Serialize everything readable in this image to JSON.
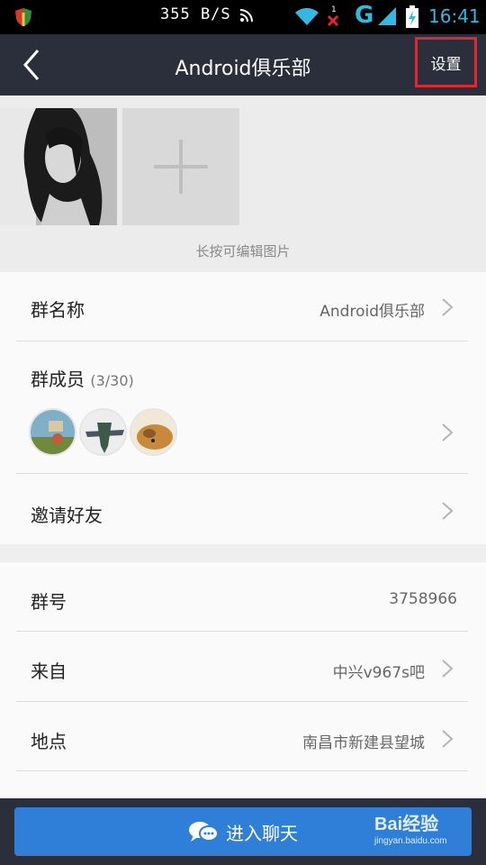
{
  "statusbar": {
    "speed": "355 B/S",
    "network": "G",
    "time": "16:41"
  },
  "titlebar": {
    "title": "Android俱乐部",
    "settings_label": "设置"
  },
  "photos": {
    "hint": "长按可编辑图片"
  },
  "group_info": {
    "name_label": "群名称",
    "name_value": "Android俱乐部",
    "members_label": "群成员",
    "members_count": "(3/30)",
    "invite_label": "邀请好友"
  },
  "group_details": {
    "number_label": "群号",
    "number_value": "3758966",
    "from_label": "来自",
    "from_value": "中兴v967s吧",
    "location_label": "地点",
    "location_value": "南昌市新建县望城"
  },
  "bottom": {
    "enter_chat_label": "进入聊天"
  },
  "watermark": {
    "brand": "Bai经验",
    "site": "jingyan.baidu.com"
  },
  "colors": {
    "titlebar": "#2b2f3b",
    "highlight_box": "#e0262f",
    "primary_button": "#2f7fd8",
    "status_accent": "#34b7e0"
  }
}
